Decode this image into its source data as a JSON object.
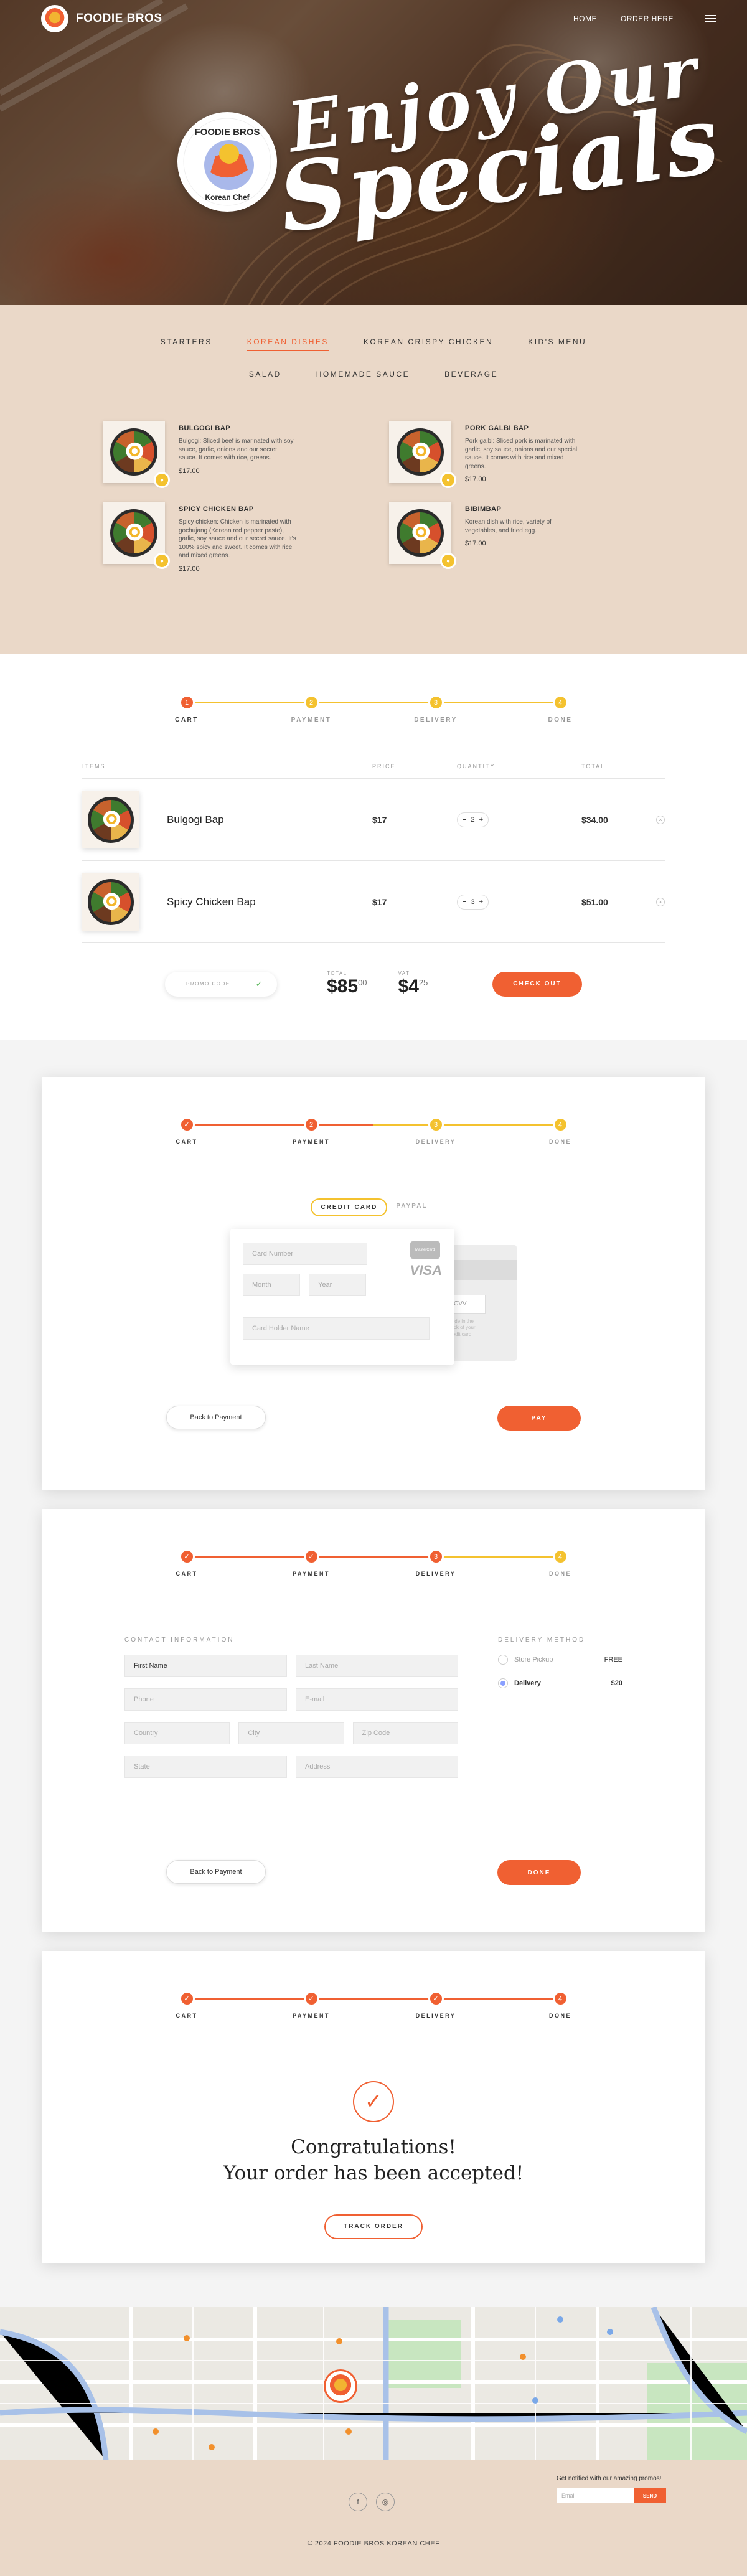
{
  "header": {
    "brand": "FOODIE BROS",
    "nav": [
      "HOME",
      "ORDER HERE"
    ]
  },
  "hero": {
    "line1": "Enjoy Our",
    "line2": "Specials",
    "logo_top": "FOODIE BROS",
    "logo_bottom": "Korean Chef"
  },
  "menu": {
    "tabs_row1": [
      "STARTERS",
      "KOREAN DISHES",
      "KOREAN CRISPY CHICKEN",
      "KID'S MENU"
    ],
    "tabs_row2": [
      "SALAD",
      "HOMEMADE SAUCE",
      "BEVERAGE"
    ],
    "active_tab": "KOREAN DISHES",
    "dishes": [
      {
        "name": "BULGOGI BAP",
        "desc": "Bulgogi: Sliced beef is marinated with soy sauce, garlic, onions and our secret sauce. It comes with rice, greens.",
        "price": "$17.00"
      },
      {
        "name": "PORK GALBI BAP",
        "desc": "Pork galbi: Sliced pork is marinated with garlic, soy sauce, onions and our special sauce. It comes with rice and mixed greens.",
        "price": "$17.00"
      },
      {
        "name": "SPICY CHICKEN BAP",
        "desc": "Spicy chicken: Chicken is marinated with gochujang (Korean red pepper paste), garlic, soy sauce and our secret sauce. It's 100% spicy and sweet. It comes with rice and mixed greens.",
        "price": "$17.00"
      },
      {
        "name": "BIBIMBAP",
        "desc": "Korean dish with rice, variety of vegetables, and fried egg.",
        "price": "$17.00"
      }
    ]
  },
  "steps": [
    "CART",
    "PAYMENT",
    "DELIVERY",
    "DONE"
  ],
  "cart": {
    "headers": [
      "ITEMS",
      "PRICE",
      "QUANTITY",
      "TOTAL"
    ],
    "items": [
      {
        "name": "Bulgogi Bap",
        "price": "$17",
        "qty": "2",
        "total": "$34.00"
      },
      {
        "name": "Spicy Chicken Bap",
        "price": "$17",
        "qty": "3",
        "total": "$51.00"
      }
    ],
    "promo_label": "PROMO CODE",
    "total_label": "TOTAL",
    "total_main": "$85",
    "total_cents": "00",
    "vat_label": "VAT",
    "vat_main": "$4",
    "vat_cents": "25",
    "checkout_label": "CHECK OUT"
  },
  "payment": {
    "tabs": [
      "CREDIT CARD",
      "PAYPAL"
    ],
    "card_number": "Card Number",
    "month": "Month",
    "year": "Year",
    "holder": "Card Holder Name",
    "cvv": "CVV",
    "cvv_hint": "Code in the back of your credit card",
    "mastercard": "MasterCard",
    "visa": "VISA",
    "back": "Back to Payment",
    "pay": "PAY"
  },
  "delivery": {
    "contact_title": "CONTACT INFORMATION",
    "method_title": "DELIVERY METHOD",
    "fields": {
      "first": "First Name",
      "last": "Last Name",
      "phone": "Phone",
      "email": "E-mail",
      "country": "Country",
      "city": "City",
      "zip": "Zip Code",
      "state": "State",
      "address": "Address"
    },
    "methods": [
      {
        "label": "Store Pickup",
        "value": "FREE"
      },
      {
        "label": "Delivery",
        "value": "$20"
      }
    ],
    "back": "Back to Payment",
    "done": "DONE"
  },
  "done": {
    "line1": "Congratulations!",
    "line2": "Your order has been accepted!",
    "track": "TRACK ORDER"
  },
  "footer": {
    "newsletter_label": "Get notified with our amazing promos!",
    "email_placeholder": "Email",
    "send": "SEND",
    "copyright": "© 2024 FOODIE BROS KOREAN CHEF"
  },
  "colors": {
    "accent": "#f06032",
    "yellow": "#f4c22f",
    "beige": "#ead8c8"
  }
}
